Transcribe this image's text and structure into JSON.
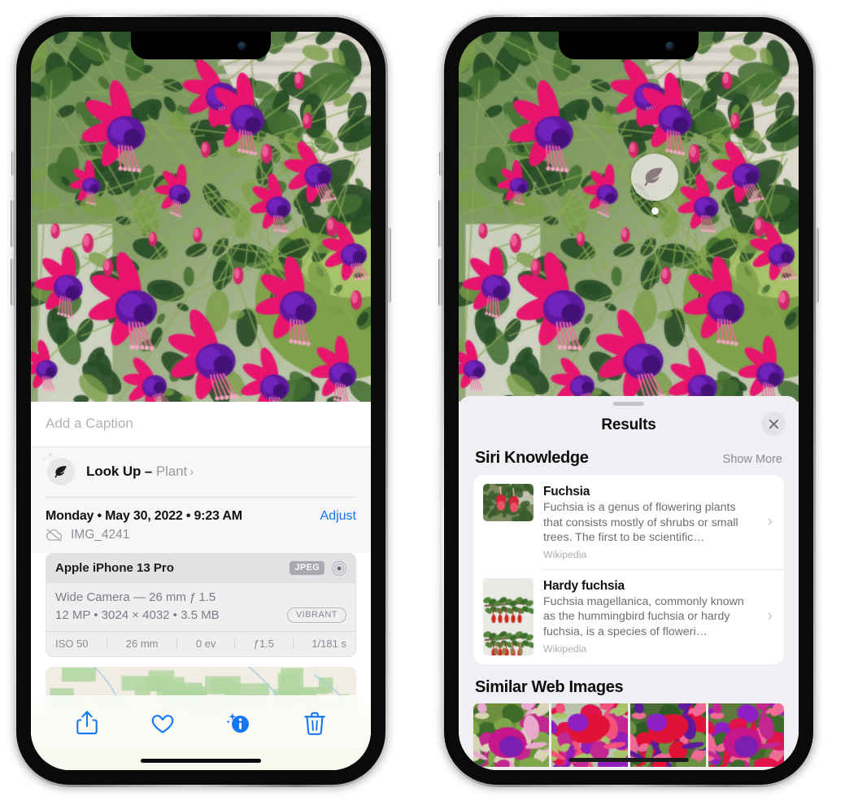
{
  "left_phone": {
    "caption_placeholder": "Add a Caption",
    "lookup": {
      "icon": "leaf-icon",
      "label": "Look Up – ",
      "subject": "Plant",
      "chevron": "›"
    },
    "date_line": "Monday • May 30, 2022 • 9:23 AM",
    "adjust_label": "Adjust",
    "filename": "IMG_4241",
    "filename_icon": "icloud-slash-icon",
    "camera_card": {
      "model": "Apple iPhone 13 Pro",
      "format_badge": "JPEG",
      "hdr_icon": "hdr-target-icon",
      "lens_line": "Wide Camera — 26 mm ƒ 1.5",
      "size_line": "12 MP • 3024 × 4032 • 3.5 MB",
      "style_badge": "VIBRANT",
      "exif": [
        "ISO 50",
        "26 mm",
        "0 ev",
        "ƒ1.5",
        "1/181 s"
      ]
    },
    "toolbar": [
      {
        "name": "share-icon",
        "label": "Share"
      },
      {
        "name": "heart-icon",
        "label": "Favorite"
      },
      {
        "name": "info-sparkle-icon",
        "label": "Info"
      },
      {
        "name": "trash-icon",
        "label": "Delete"
      }
    ]
  },
  "right_phone": {
    "photo_badge_icon": "leaf-icon",
    "sheet_title": "Results",
    "close_icon": "close-icon",
    "siri_section": {
      "title": "Siri Knowledge",
      "show_more": "Show More",
      "items": [
        {
          "title": "Fuchsia",
          "description": "Fuchsia is a genus of flowering plants that consists mostly of shrubs or small trees. The first to be scientific…",
          "source": "Wikipedia",
          "chevron": "›"
        },
        {
          "title": "Hardy fuchsia",
          "description": "Fuchsia magellanica, commonly known as the hummingbird fuchsia or hardy fuchsia, is a species of floweri…",
          "source": "Wikipedia",
          "chevron": "›"
        }
      ]
    },
    "web_section": {
      "title": "Similar Web Images",
      "thumbnails": [
        "web-image-1",
        "web-image-2",
        "web-image-3",
        "web-image-4"
      ]
    }
  },
  "colors": {
    "accent_blue": "#1476f5",
    "sheet_gray": "#f0f0f4",
    "card_white": "#ffffff",
    "secondary_text": "#8b8b91",
    "flower_pink": "#e8156e",
    "flower_purple": "#5e1a9e"
  }
}
